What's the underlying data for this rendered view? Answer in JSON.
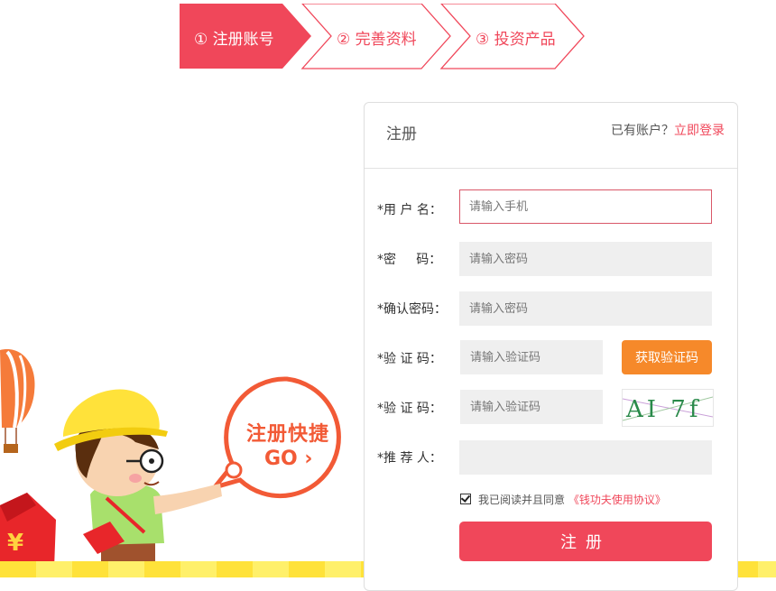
{
  "steps": [
    {
      "label": "① 注册账号",
      "active": true
    },
    {
      "label": "② 完善资料",
      "active": false
    },
    {
      "label": "③ 投资产品",
      "active": false
    }
  ],
  "promo": {
    "bubble_line1": "注册快捷",
    "bubble_line2": "GO ›"
  },
  "panel": {
    "title": "注册",
    "has_account_text": "已有账户？",
    "login_link": "立即登录"
  },
  "form": {
    "username": {
      "label": "*用 户 名：",
      "placeholder": "请输入手机",
      "value": ""
    },
    "password": {
      "label": "*密     码：",
      "placeholder": "请输入密码",
      "value": ""
    },
    "confirm_password": {
      "label": "*确认密码：",
      "placeholder": "请输入密码",
      "value": ""
    },
    "sms_code": {
      "label": "*验 证 码：",
      "placeholder": "请输入验证码",
      "value": "",
      "button_label": "获取验证码"
    },
    "image_code": {
      "label": "*验 证 码：",
      "placeholder": "请输入验证码",
      "value": "",
      "captcha_text": "AI 7f"
    },
    "referrer": {
      "label": "*推 荐 人：",
      "placeholder": "",
      "value": ""
    },
    "agree_text": "我已阅读并且同意",
    "protocol_link": "《钱功夫使用协议》",
    "agreed": true,
    "submit_label": "注册"
  },
  "colors": {
    "primary": "#f0475a",
    "orange": "#f6892a",
    "input_bg": "#efefef"
  }
}
